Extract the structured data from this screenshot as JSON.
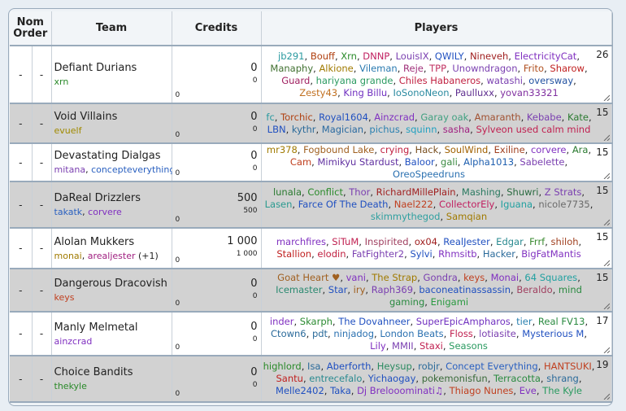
{
  "colors": {
    "accent": "#9ab"
  },
  "table": {
    "headers": {
      "nom_order": "Nom Order",
      "team": "Team",
      "credits": "Credits",
      "players": "Players"
    },
    "rows": [
      {
        "dash1": "-",
        "dash2": "-",
        "team": "Defiant Durians",
        "managers": [
          {
            "name": "xrn",
            "color": "#2a8a2a"
          }
        ],
        "credits": "0",
        "credits_small": "0",
        "credits_zero": "0",
        "count": "26",
        "players": [
          [
            "jb291",
            "#2a9aa0"
          ],
          [
            "Bouff",
            "#b04010"
          ],
          [
            "Xrn",
            "#2a8a2a"
          ],
          [
            "DNNP",
            "#c02060"
          ],
          [
            "LouisIX",
            "#7a3fb0"
          ],
          [
            "QWILY",
            "#2050c0"
          ],
          [
            "Nineveh",
            "#a02020"
          ],
          [
            "ElectricityCat",
            "#8030c0"
          ],
          [
            "Manaphy",
            "#407030"
          ],
          [
            "Alkione",
            "#a07a00"
          ],
          [
            "Vileman",
            "#2a7ab0"
          ],
          [
            "Reje",
            "#a0307a"
          ],
          [
            "TPP",
            "#c03060"
          ],
          [
            "Unowndragon",
            "#7a3fb0"
          ],
          [
            "Frito",
            "#b05020"
          ],
          [
            "Sharow",
            "#c02020"
          ],
          [
            "Guard",
            "#a02060"
          ],
          [
            "hariyana grande",
            "#2a9a60"
          ],
          [
            "Chiles Habaneros",
            "#c02040"
          ],
          [
            "watashi",
            "#7a3fb0"
          ],
          [
            "oversway",
            "#2050a0"
          ],
          [
            "Zesty43",
            "#c07020"
          ],
          [
            "King Billu",
            "#7030c0"
          ],
          [
            "IoSonoNeon",
            "#2a8aa0"
          ],
          [
            "Paulluxx",
            "#603090"
          ],
          [
            "yovan33321",
            "#8030a0"
          ]
        ]
      },
      {
        "dash1": "-",
        "dash2": "-",
        "team": "Void Villains",
        "managers": [
          {
            "name": "evuelf",
            "color": "#a08a00"
          }
        ],
        "credits": "0",
        "credits_small": "0",
        "credits_zero": "0",
        "count": "15",
        "players": [
          [
            "fc",
            "#2a9aa0"
          ],
          [
            "Torchic",
            "#b04010"
          ],
          [
            "Royal1604",
            "#2050c0"
          ],
          [
            "Ainzcrad",
            "#8030c0"
          ],
          [
            "Garay oak",
            "#40a080"
          ],
          [
            "Amaranth",
            "#a05030"
          ],
          [
            "Kebabe",
            "#7a3fb0"
          ],
          [
            "Kate",
            "#2a7a30"
          ],
          [
            "LBN",
            "#2050c0"
          ],
          [
            "kythr",
            "#2a6a9a"
          ],
          [
            "Magician",
            "#2a6aa0"
          ],
          [
            "pichus",
            "#2a80b0"
          ],
          [
            "squinn",
            "#20a0c0"
          ],
          [
            "sasha",
            "#a02080"
          ],
          [
            "Sylveon used calm mind",
            "#c02050"
          ]
        ]
      },
      {
        "dash1": "-",
        "dash2": "-",
        "team": "Devastating Dialgas",
        "managers": [
          {
            "name": "mitana",
            "color": "#7a3fb0"
          },
          {
            "name": "concepteverything",
            "color": "#2a60c0"
          }
        ],
        "credits": "0",
        "credits_small": "0",
        "credits_zero": "0",
        "count": "15",
        "players": [
          [
            "mr378",
            "#a07a00"
          ],
          [
            "Fogbound Lake",
            "#a06020"
          ],
          [
            "crying",
            "#c02040"
          ],
          [
            "Hack",
            "#7a5020"
          ],
          [
            "SoulWind",
            "#a06000"
          ],
          [
            "Exiline",
            "#a04020"
          ],
          [
            "corvere",
            "#8030c0"
          ],
          [
            "Ara",
            "#2a7a30"
          ],
          [
            "Cam",
            "#c04020"
          ],
          [
            "Mimikyu Stardust",
            "#6030a0"
          ],
          [
            "Baloor",
            "#2050c0"
          ],
          [
            "gali",
            "#3a8a40"
          ],
          [
            "Alpha1013",
            "#2060b0"
          ],
          [
            "Sabelette",
            "#7a3fb0"
          ],
          [
            "OreoSpeedruns",
            "#2a70b0"
          ]
        ]
      },
      {
        "dash1": "-",
        "dash2": "-",
        "team": "DaReal Drizzlers",
        "managers": [
          {
            "name": "takatk",
            "color": "#2a60c0"
          },
          {
            "name": "corvere",
            "color": "#8030c0"
          }
        ],
        "credits": "500",
        "credits_small": "500",
        "credits_zero": "0",
        "count": "15",
        "players": [
          [
            "lunala",
            "#2a7a30"
          ],
          [
            "Conflict",
            "#2a8a2a"
          ],
          [
            "Thor",
            "#7a3fb0"
          ],
          [
            "RichardMillePlain",
            "#a02020"
          ],
          [
            "Mashing",
            "#2a7a60"
          ],
          [
            "Shuwri",
            "#2a6a40"
          ],
          [
            "Z Strats",
            "#7a3fb0"
          ],
          [
            "Lasen",
            "#2a9a90"
          ],
          [
            "Farce Of The Death",
            "#2050c0"
          ],
          [
            "Nael222",
            "#c04020"
          ],
          [
            "CollectorEly",
            "#c02060"
          ],
          [
            "Iguana",
            "#20a0a0"
          ],
          [
            "nicole7735",
            "#6a6a6a"
          ],
          [
            "skimmythegod",
            "#30a0a0"
          ],
          [
            "Samqian",
            "#a07a00"
          ]
        ]
      },
      {
        "dash1": "-",
        "dash2": "-",
        "team": "Alolan Mukkers",
        "managers": [
          {
            "name": "monai",
            "color": "#a07a00"
          },
          {
            "name": "arealjester",
            "color": "#a02080"
          }
        ],
        "managers_extra": "(+1)",
        "credits": "1 000",
        "credits_small": "1 000",
        "credits_zero": "0",
        "count": "15",
        "players": [
          [
            "marchfires",
            "#8030c0"
          ],
          [
            "SiTuM",
            "#c02050"
          ],
          [
            "Inspirited",
            "#a04060"
          ],
          [
            "ox04",
            "#a02020"
          ],
          [
            "RealJester",
            "#2050c0"
          ],
          [
            "Edgar",
            "#2a8a90"
          ],
          [
            "Frrf",
            "#3a8a30"
          ],
          [
            "shiloh",
            "#a04020"
          ],
          [
            "Stallion",
            "#c02020"
          ],
          [
            "elodin",
            "#c02040"
          ],
          [
            "FatFighter2",
            "#7a3fb0"
          ],
          [
            "Sylvi",
            "#2050c0"
          ],
          [
            "Rhmsitb",
            "#8030c0"
          ],
          [
            "Hacker",
            "#2a6a9a"
          ],
          [
            "BigFatMantis",
            "#8030c0"
          ]
        ]
      },
      {
        "dash1": "-",
        "dash2": "-",
        "team": "Dangerous Dracovish",
        "managers": [
          {
            "name": "keys",
            "color": "#c04020"
          }
        ],
        "credits": "0",
        "credits_small": "0",
        "credits_zero": "0",
        "count": "15",
        "players": [
          [
            "Goat Heart ♥",
            "#a06020"
          ],
          [
            "vani",
            "#8030c0"
          ],
          [
            "The Strap",
            "#a07a00"
          ],
          [
            "Gondra",
            "#7a3fb0"
          ],
          [
            "keys",
            "#c04020"
          ],
          [
            "Monai",
            "#8030c0"
          ],
          [
            "64 Squares",
            "#20a0a0"
          ],
          [
            "Icemaster",
            "#2a8a70"
          ],
          [
            "Star",
            "#2050c0"
          ],
          [
            "iry",
            "#a06020"
          ],
          [
            "Raph369",
            "#7a3fb0"
          ],
          [
            "baconeatinassassin",
            "#2050c0"
          ],
          [
            "Beraldo",
            "#a04060"
          ],
          [
            "mind gaming",
            "#2a8a40"
          ],
          [
            "Enigami",
            "#2a9a40"
          ]
        ]
      },
      {
        "dash1": "-",
        "dash2": "-",
        "team": "Manly Melmetal",
        "managers": [
          {
            "name": "ainzcrad",
            "color": "#8030c0"
          }
        ],
        "credits": "0",
        "credits_small": "0",
        "credits_zero": "0",
        "count": "17",
        "players": [
          [
            "inder",
            "#8030c0"
          ],
          [
            "Skarph",
            "#2a8a30"
          ],
          [
            "The Dovahneer",
            "#2050c0"
          ],
          [
            "SuperEpicAmpharos",
            "#7030c0"
          ],
          [
            "tier",
            "#2a80b0"
          ],
          [
            "Real FV13",
            "#2a8a40"
          ],
          [
            "Ctown6",
            "#2a6a9a"
          ],
          [
            "pdt",
            "#2a6a9a"
          ],
          [
            "ninjadog",
            "#2a70b0"
          ],
          [
            "London Beats",
            "#2a70b0"
          ],
          [
            "Floss",
            "#c02050"
          ],
          [
            "lotiasite",
            "#7a3fb0"
          ],
          [
            "Mysterious M",
            "#2050c0"
          ],
          [
            "Lily",
            "#8030c0"
          ],
          [
            "MMII",
            "#7a3fb0"
          ],
          [
            "Staxi",
            "#c02050"
          ],
          [
            "Seasons",
            "#2a9a60"
          ]
        ]
      },
      {
        "dash1": "-",
        "dash2": "-",
        "team": "Choice Bandits",
        "managers": [
          {
            "name": "thekyle",
            "color": "#2a8a2a"
          }
        ],
        "credits": "0",
        "credits_small": "0",
        "credits_zero": "0",
        "count": "19",
        "players": [
          [
            "highlord",
            "#2a8a2a"
          ],
          [
            "Isa",
            "#2a6a9a"
          ],
          [
            "Aberforth",
            "#2050c0"
          ],
          [
            "Heysup",
            "#2a8a60"
          ],
          [
            "robjr",
            "#2a6a9a"
          ],
          [
            "Concept Everything",
            "#2a60c0"
          ],
          [
            "HANTSUKI",
            "#c04020"
          ],
          [
            "Santu",
            "#c02020"
          ],
          [
            "entrecefalo",
            "#2a8a90"
          ],
          [
            "Yichaogay",
            "#2050c0"
          ],
          [
            "pokemonisfun",
            "#3a6a3a"
          ],
          [
            "Terracotta",
            "#2a8a40"
          ],
          [
            "shrang",
            "#2a6a9a"
          ],
          [
            "Melle2402",
            "#2050c0"
          ],
          [
            "Taka",
            "#2050c0"
          ],
          [
            "Dj Brelooominati♫",
            "#8030c0"
          ],
          [
            "Thiago Nunes",
            "#c04020"
          ],
          [
            "Eve",
            "#8030c0"
          ],
          [
            "The Kyle",
            "#2a9a60"
          ]
        ]
      }
    ]
  }
}
